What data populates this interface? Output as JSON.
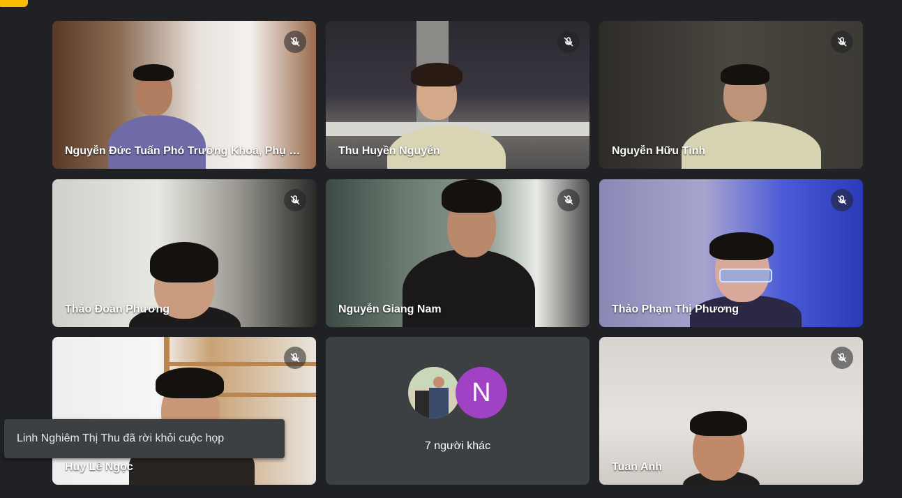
{
  "participants": [
    {
      "name": "Nguyễn Đức Tuấn Phó Trưởng Khoa, Phụ t...",
      "muted_icon": "mic-off-icon"
    },
    {
      "name": "Thu Huyền Nguyễn",
      "muted_icon": "mic-off-icon"
    },
    {
      "name": "Nguyễn Hữu Tình",
      "muted_icon": "mic-off-icon"
    },
    {
      "name": "Thảo Đoàn Phương",
      "muted_icon": "mic-off-icon"
    },
    {
      "name": "Nguyễn Giang Nam",
      "muted_icon": "mic-off-icon"
    },
    {
      "name": "Thảo Phạm Thị Phương",
      "muted_icon": "mic-off-icon"
    },
    {
      "name": "Huy Lê Ngọc",
      "muted_icon": "mic-off-icon"
    },
    {
      "name": "Tuan Anh",
      "muted_icon": "mic-off-icon"
    }
  ],
  "others": {
    "avatar_letter": "N",
    "avatar_color": "#a142c4",
    "label": "7 người khác"
  },
  "notification": {
    "text": "Linh Nghiêm Thị Thu đã rời khỏi cuộc họp"
  },
  "colors": {
    "background": "#202124",
    "tile": "#3c4043",
    "accent": "#fbbc04"
  }
}
